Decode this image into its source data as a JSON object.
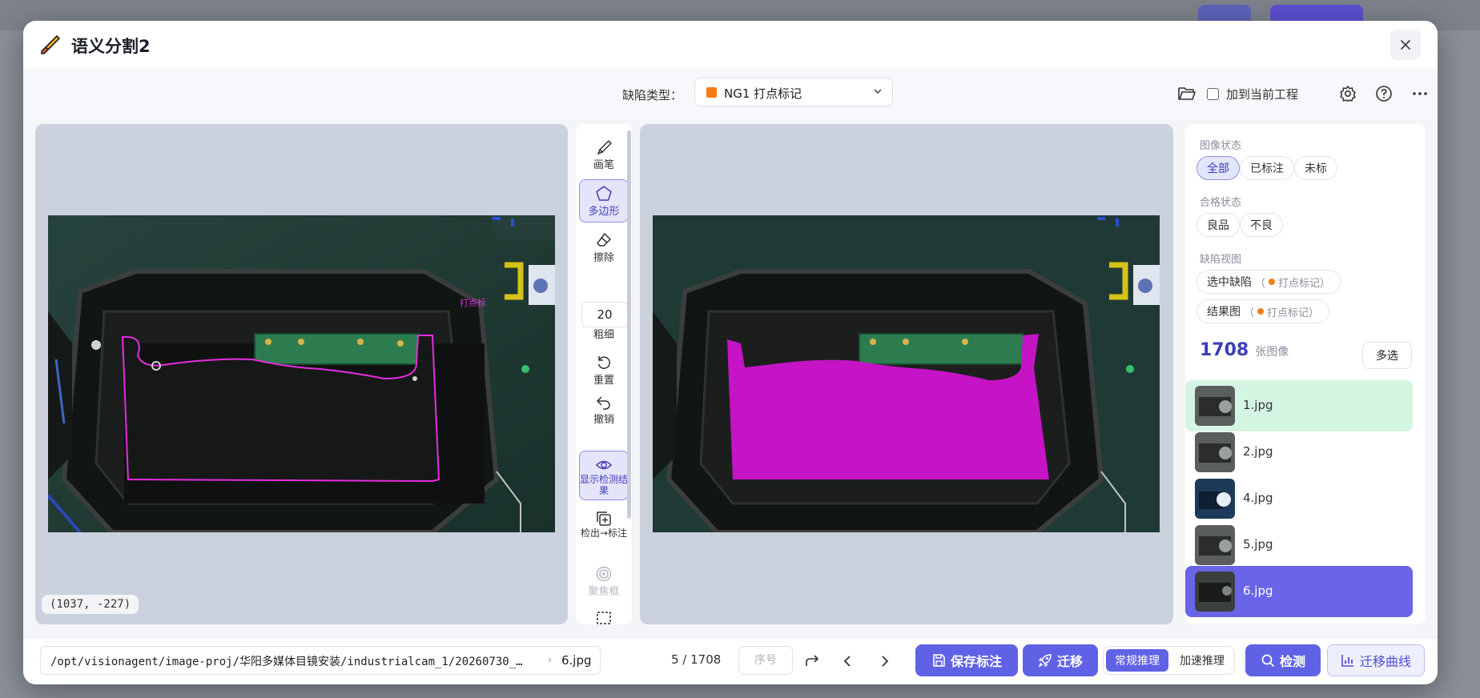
{
  "dialog": {
    "title": "语义分割2"
  },
  "toolbar": {
    "defect_type_label": "缺陷类型：",
    "defect_type_value": "NG1 打点标记",
    "defect_color": "#f47c12",
    "add_to_project_label": "加到当前工程",
    "add_to_project_checked": false,
    "icons": [
      "folder-open-icon",
      "settings-icon",
      "help-icon",
      "more-icon"
    ]
  },
  "tools": {
    "brush": "画笔",
    "polygon": "多边形",
    "eraser": "擦除",
    "thickness_value": "20",
    "thickness_label": "粗细",
    "reset": "重置",
    "undo": "撤销",
    "show_result": "显示检测结果",
    "detect_to_label": "检出→标注",
    "focus_box": "聚焦框",
    "active_tool": "polygon"
  },
  "canvas": {
    "coordinate": "(1037, -227)",
    "annotation_label": "打点标"
  },
  "sidebar": {
    "image_state_title": "图像状态",
    "image_state_options": [
      "全部",
      "已标注",
      "未标"
    ],
    "image_state_selected": "全部",
    "pass_state_title": "合格状态",
    "pass_state_options": [
      "良品",
      "不良"
    ],
    "defect_view_title": "缺陷视图",
    "selected_defect_label": "选中缺陷",
    "selected_defect_value": "打点标记",
    "result_view_label": "结果图",
    "result_view_value": "打点标记",
    "image_count": "1708",
    "image_count_unit": "张图像",
    "multi_select_label": "多选",
    "images": [
      {
        "name": "1.jpg",
        "state": "selected"
      },
      {
        "name": "2.jpg",
        "state": "normal"
      },
      {
        "name": "4.jpg",
        "state": "normal"
      },
      {
        "name": "5.jpg",
        "state": "normal"
      },
      {
        "name": "6.jpg",
        "state": "current"
      }
    ]
  },
  "footer": {
    "path": "/opt/visionagent/image-proj/华阳多媒体目镜安装/industrialcam_1/20260730_…",
    "separator": "›",
    "file": "6.jpg",
    "pager": "5 / 1708",
    "seq_placeholder": "序号",
    "save_label": "保存标注",
    "migrate_label": "迁移",
    "normal_infer_label": "常规推理",
    "fast_infer_label": "加速推理",
    "detect_label": "检测",
    "migrate_curve_label": "迁移曲线"
  }
}
